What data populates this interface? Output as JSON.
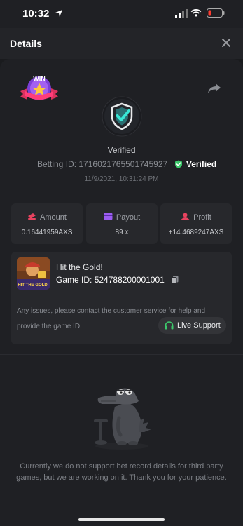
{
  "status_bar": {
    "time": "10:32"
  },
  "header": {
    "title": "Details"
  },
  "bet": {
    "verified_label": "Verified",
    "betting_id_label": "Betting ID:",
    "betting_id": "1716021765501745927",
    "verified_badge": "Verified",
    "date": "11/9/2021, 10:31:24 PM",
    "win_badge": "WIN"
  },
  "stats": [
    {
      "label": "Amount",
      "value": "0.16441959AXS"
    },
    {
      "label": "Payout",
      "value": "89 x"
    },
    {
      "label": "Profit",
      "value": "+14.4689247AXS"
    }
  ],
  "game": {
    "name": "Hit the Gold!",
    "id_label": "Game ID:",
    "id": "524788200001001",
    "thumb_text": "HIT THE GOLD!",
    "issue_text": "Any issues, please contact the customer service for help and provide the game ID.",
    "live_support": "Live Support"
  },
  "notice": "Currently we do not support bet record details for third party games, but we are working on it. Thank you for your patience.",
  "colors": {
    "accent_green": "#3cc96b",
    "background": "#1f2024",
    "card": "#27282c"
  }
}
